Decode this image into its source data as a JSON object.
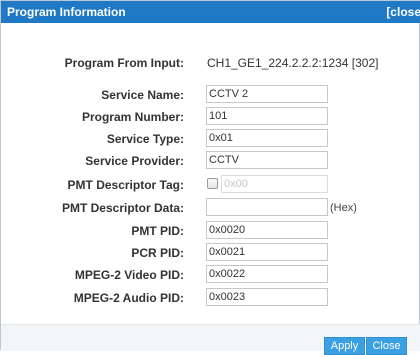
{
  "dialog": {
    "title": "Program Information",
    "close_label": "[close"
  },
  "fields": {
    "program_from_input": {
      "label": "Program From Input:",
      "value": "CH1_GE1_224.2.2.2:1234 [302]"
    },
    "service_name": {
      "label": "Service Name:",
      "value": "CCTV 2"
    },
    "program_number": {
      "label": "Program Number:",
      "value": "101"
    },
    "service_type": {
      "label": "Service Type:",
      "value": "0x01"
    },
    "service_provider": {
      "label": "Service Provider:",
      "value": "CCTV"
    },
    "pmt_descriptor_tag": {
      "label": "PMT Descriptor Tag:",
      "value": "0x00",
      "checked": false
    },
    "pmt_descriptor_data": {
      "label": "PMT Descriptor Data:",
      "value": "",
      "unit": "(Hex)"
    },
    "pmt_pid": {
      "label": "PMT PID:",
      "value": "0x0020"
    },
    "pcr_pid": {
      "label": "PCR PID:",
      "value": "0x0021"
    },
    "mpeg2_video_pid": {
      "label": "MPEG-2 Video PID:",
      "value": "0x0022"
    },
    "mpeg2_audio_pid": {
      "label": "MPEG-2 Audio PID:",
      "value": "0x0023"
    }
  },
  "buttons": {
    "apply": "Apply",
    "close": "Close"
  },
  "colors": {
    "titlebar": "#1f79c4",
    "button": "#3aa0e1"
  }
}
